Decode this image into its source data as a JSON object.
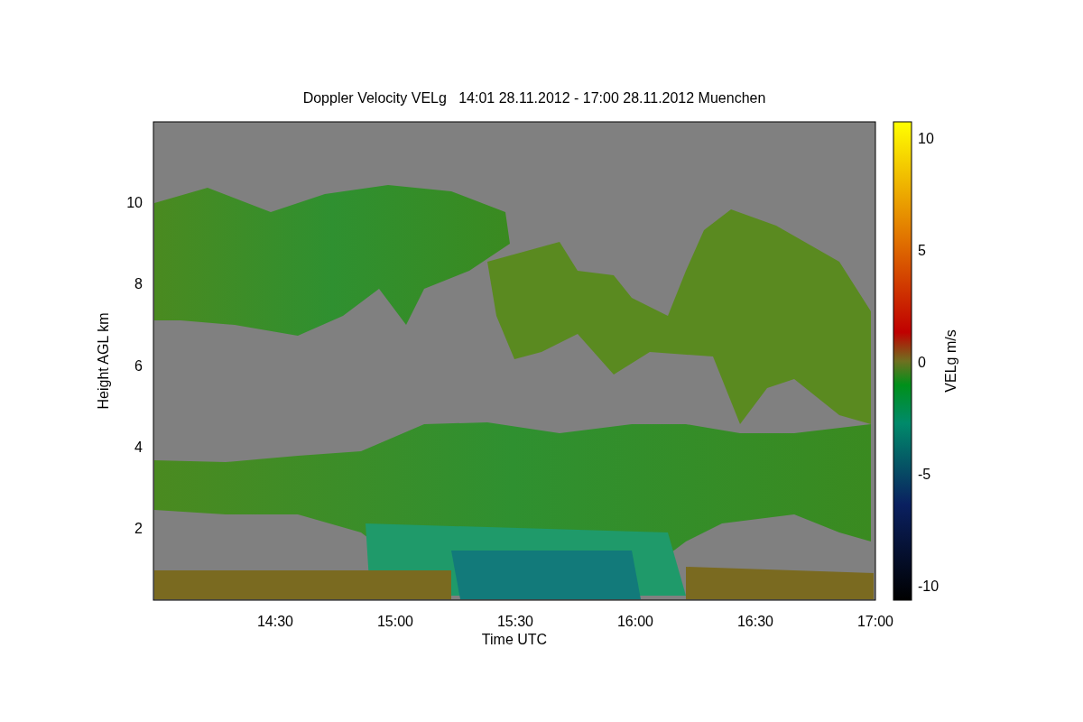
{
  "title": "Doppler Velocity VELg   14:01 28.11.2012 - 17:00 28.11.2012 Muenchen",
  "y_axis": {
    "label": "Height AGL km",
    "ticks": [
      "10",
      "8",
      "6",
      "4",
      "2"
    ]
  },
  "x_axis": {
    "label": "Time UTC",
    "ticks": [
      "14:30",
      "15:00",
      "15:30",
      "16:00",
      "16:30",
      "17:00"
    ]
  },
  "colorbar": {
    "label": "VELg m/s",
    "ticks": [
      "10",
      "5",
      "0",
      "-5",
      "-10"
    ]
  }
}
